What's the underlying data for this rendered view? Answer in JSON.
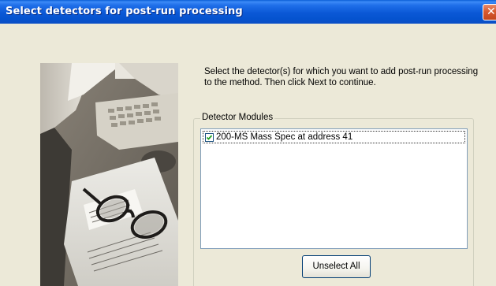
{
  "window": {
    "title": "Select detectors for post-run processing",
    "close_glyph": "✕"
  },
  "instruction": "Select the detector(s) for which you want to add post-run processing to the method. Then click Next to continue.",
  "detector_group": {
    "label": "Detector Modules",
    "items": [
      {
        "label": "200-MS Mass Spec at address 41",
        "checked": true
      }
    ]
  },
  "buttons": {
    "unselect_all": "Unselect All"
  },
  "colors": {
    "dialog_bg": "#ece9d8",
    "titlebar_blue": "#0b58d6",
    "close_red": "#d75a31",
    "listbox_border": "#7f9db9",
    "button_border": "#003c74"
  },
  "icons": {
    "photo": "office-desk-photo-with-glasses",
    "close": "close-icon",
    "check": "checkmark-icon"
  }
}
